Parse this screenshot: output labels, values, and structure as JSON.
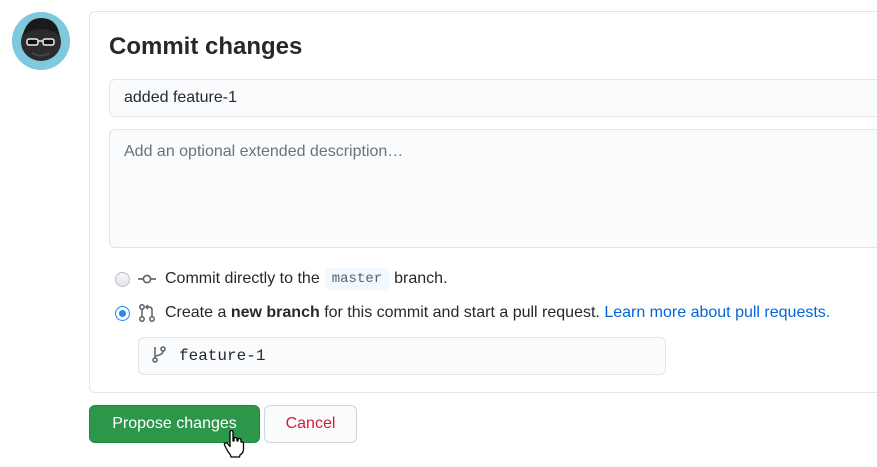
{
  "form": {
    "title": "Commit changes",
    "summary_value": "added feature-1",
    "description_placeholder": "Add an optional extended description…"
  },
  "options": {
    "direct": {
      "prefix": "Commit directly to the",
      "branch": "master",
      "suffix": "branch.",
      "checked": false
    },
    "new_branch": {
      "prefix": "Create a",
      "bold": "new branch",
      "suffix": "for this commit and start a pull request.",
      "link": "Learn more about pull requests.",
      "checked": true
    }
  },
  "branch_name": "feature-1",
  "buttons": {
    "propose": "Propose changes",
    "cancel": "Cancel"
  },
  "colors": {
    "primary": "#2c974b",
    "link": "#0366d6",
    "danger": "#cb2431"
  },
  "icons": [
    "avatar",
    "git-commit-icon",
    "git-pull-request-icon",
    "git-branch-icon",
    "hand-cursor-icon"
  ]
}
